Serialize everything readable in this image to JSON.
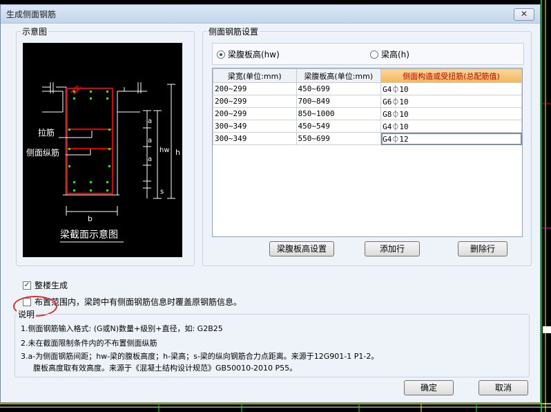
{
  "title": "生成侧面钢筋",
  "close_label": "✕",
  "diagram": {
    "group_label": "示意图",
    "label_tie": "拉筋",
    "label_side_bar": "侧面纵筋",
    "caption": "梁截面示意图",
    "dim_a": "a",
    "dim_hw": "hw",
    "dim_h": "h",
    "dim_s": "s",
    "dim_b": "b"
  },
  "settings": {
    "group_label": "侧面钢筋设置",
    "radio_hw": "梁腹板高(hw)",
    "radio_h": "梁高(h)",
    "radio_selected": "hw",
    "columns": [
      "梁宽(单位:mm)",
      "梁腹板高(单位:mm)",
      "侧面构造或受扭筋(总配筋值)"
    ],
    "rows": [
      [
        "200~299",
        "450~699",
        "G4⏀10"
      ],
      [
        "200~299",
        "700~849",
        "G6⏀10"
      ],
      [
        "200~299",
        "850~1000",
        "G8⏀10"
      ],
      [
        "300~349",
        "450~549",
        "G4⏀10"
      ],
      [
        "300~349",
        "550~699",
        "G4⏀12"
      ]
    ],
    "btn_web_height": "梁腹板高设置",
    "btn_add_row": "添加行",
    "btn_delete_row": "删除行"
  },
  "options": {
    "whole_floor": "整楼生成",
    "whole_floor_checked": true,
    "overwrite": "布置范围内，梁跨中有侧面钢筋信息时覆盖原钢筋信息。",
    "overwrite_checked": false
  },
  "notes": {
    "label": "说明",
    "line1": "1.侧面钢筋输入格式: (G或N)数量+级别+直径，如: G2B25",
    "line2": "2.未在截面限制条件内的不布置侧面纵筋",
    "line3": "3.a-为侧面钢筋间距；hw-梁的腹板高度；h-梁高；s-梁的纵向钢筋合力点距离。来源于12G901-1 P1-2。",
    "line4": "腹板高度取有效高度。来源于《混凝土结构设计规范》GB50010-2010 P55。"
  },
  "footer": {
    "ok": "确定",
    "cancel": "取消"
  },
  "colors": {
    "accent_header": "#f5b75a",
    "rebar": "#e00000",
    "dots": "#00ff00",
    "annotation": "#e0302a"
  }
}
